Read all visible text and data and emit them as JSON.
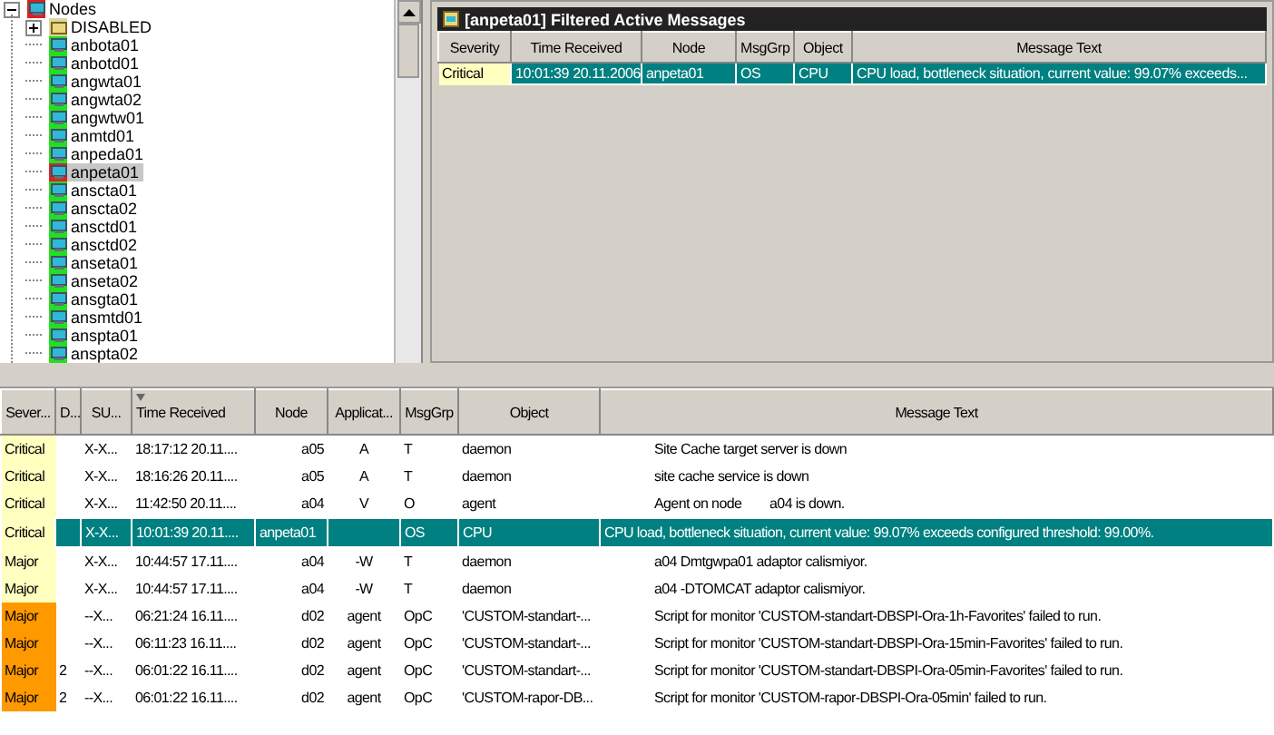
{
  "tree": {
    "label": "Nodes",
    "expanded": true,
    "color": "#e02020",
    "children": [
      {
        "kind": "group",
        "label": "DISABLED",
        "expanded": false,
        "color": "#d8d8a0",
        "selected": false
      },
      {
        "kind": "node",
        "label": "anbota01",
        "color": "#20e020",
        "selected": false
      },
      {
        "kind": "node",
        "label": "anbotd01",
        "color": "#20e020",
        "selected": false
      },
      {
        "kind": "node",
        "label": "angwta01",
        "color": "#20e020",
        "selected": false
      },
      {
        "kind": "node",
        "label": "angwta02",
        "color": "#20e020",
        "selected": false
      },
      {
        "kind": "node",
        "label": "angwtw01",
        "color": "#20e020",
        "selected": false
      },
      {
        "kind": "node",
        "label": "anmtd01",
        "color": "#20e020",
        "selected": false
      },
      {
        "kind": "node",
        "label": "anpeda01",
        "color": "#20e020",
        "selected": false
      },
      {
        "kind": "node",
        "label": "anpeta01",
        "color": "#e02020",
        "selected": true
      },
      {
        "kind": "node",
        "label": "anscta01",
        "color": "#20e020",
        "selected": false
      },
      {
        "kind": "node",
        "label": "anscta02",
        "color": "#20e020",
        "selected": false
      },
      {
        "kind": "node",
        "label": "ansctd01",
        "color": "#20e020",
        "selected": false
      },
      {
        "kind": "node",
        "label": "ansctd02",
        "color": "#20e020",
        "selected": false
      },
      {
        "kind": "node",
        "label": "anseta01",
        "color": "#20e020",
        "selected": false
      },
      {
        "kind": "node",
        "label": "anseta02",
        "color": "#20e020",
        "selected": false
      },
      {
        "kind": "node",
        "label": "ansgta01",
        "color": "#20e020",
        "selected": false
      },
      {
        "kind": "node",
        "label": "ansmtd01",
        "color": "#20e020",
        "selected": false
      },
      {
        "kind": "node",
        "label": "anspta01",
        "color": "#20e020",
        "selected": false
      },
      {
        "kind": "node",
        "label": "anspta02",
        "color": "#20e020",
        "selected": false
      }
    ]
  },
  "filtered_panel": {
    "title": "[anpeta01] Filtered Active Messages",
    "columns": [
      "Severity",
      "Time Received",
      "Node",
      "MsgGrp",
      "Object",
      "Message Text"
    ],
    "rows": [
      {
        "selected": true,
        "color": "#ffffc0",
        "cells": [
          "Critical",
          "10:01:39 20.11.2006",
          "anpeta01",
          "OS",
          "CPU",
          "CPU load, bottleneck situation, current value: 99.07% exceeds..."
        ]
      }
    ]
  },
  "message_table": {
    "columns": [
      {
        "label": "Sever...",
        "sorted": false
      },
      {
        "label": "D...",
        "sorted": false
      },
      {
        "label": "SU...",
        "sorted": false
      },
      {
        "label": "Time Received",
        "sorted": true
      },
      {
        "label": "Node",
        "sorted": false
      },
      {
        "label": "Applicat...",
        "sorted": false
      },
      {
        "label": "MsgGrp",
        "sorted": false
      },
      {
        "label": "Object",
        "sorted": false
      },
      {
        "label": "Message Text",
        "sorted": false
      }
    ],
    "rows": [
      {
        "selected": false,
        "color": "#ffffc0",
        "cells": [
          "Critical",
          "",
          "X-X...",
          "18:17:12 20.11....",
          "a05",
          "A",
          "T",
          "daemon",
          "Site Cache target server is down"
        ]
      },
      {
        "selected": false,
        "color": "#ffffc0",
        "cells": [
          "Critical",
          "",
          "X-X...",
          "18:16:26 20.11....",
          "a05",
          "A",
          "T",
          "daemon",
          "site cache service is down"
        ]
      },
      {
        "selected": false,
        "color": "#ffffc0",
        "cells": [
          "Critical",
          "",
          "X-X...",
          "11:42:50 20.11....",
          "a04",
          "V",
          "O",
          "agent",
          "Agent on node        a04 is down."
        ]
      },
      {
        "selected": true,
        "color": "#ffffc0",
        "cells": [
          "Critical",
          "",
          "X-X...",
          "10:01:39 20.11....",
          "anpeta01",
          "",
          "OS",
          "CPU",
          "CPU load, bottleneck situation, current value: 99.07% exceeds configured threshold: 99.00%."
        ]
      },
      {
        "selected": false,
        "color": "#ffffc0",
        "cells": [
          "Major",
          "",
          "X-X...",
          "10:44:57 17.11....",
          "a04",
          "-W",
          "T",
          "daemon",
          "a04 Dmtgwpa01 adaptor calismiyor."
        ]
      },
      {
        "selected": false,
        "color": "#ffffc0",
        "cells": [
          "Major",
          "",
          "X-X...",
          "10:44:57 17.11....",
          "a04",
          "-W",
          "T",
          "daemon",
          "a04 -DTOMCAT adaptor calismiyor."
        ]
      },
      {
        "selected": false,
        "color": "#ff9900",
        "cells": [
          "Major",
          "",
          "--X...",
          "06:21:24 16.11....",
          "d02",
          "agent",
          "OpC",
          "'CUSTOM-standart-...",
          "Script for monitor 'CUSTOM-standart-DBSPI-Ora-1h-Favorites' failed to run."
        ]
      },
      {
        "selected": false,
        "color": "#ff9900",
        "cells": [
          "Major",
          "",
          "--X...",
          "06:11:23 16.11....",
          "d02",
          "agent",
          "OpC",
          "'CUSTOM-standart-...",
          "Script for monitor 'CUSTOM-standart-DBSPI-Ora-15min-Favorites' failed to run."
        ]
      },
      {
        "selected": false,
        "color": "#ff9900",
        "cells": [
          "Major",
          "2",
          "--X...",
          "06:01:22 16.11....",
          "d02",
          "agent",
          "OpC",
          "'CUSTOM-standart-...",
          "Script for monitor 'CUSTOM-standart-DBSPI-Ora-05min-Favorites' failed to run."
        ]
      },
      {
        "selected": false,
        "color": "#ff9900",
        "cells": [
          "Major",
          "2",
          "--X...",
          "06:01:22 16.11....",
          "d02",
          "agent",
          "OpC",
          "'CUSTOM-rapor-DB...",
          "Script for monitor 'CUSTOM-rapor-DBSPI-Ora-05min' failed to run."
        ]
      }
    ]
  }
}
